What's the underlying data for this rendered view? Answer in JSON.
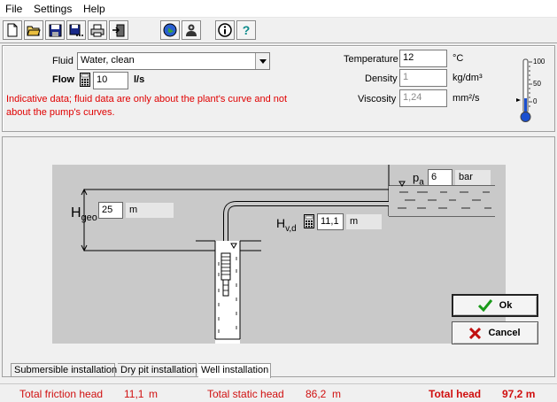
{
  "menu": {
    "file": "File",
    "settings": "Settings",
    "help": "Help"
  },
  "toolbar_icons": [
    "new-document-icon",
    "open-folder-icon",
    "save-icon",
    "save-as-icon",
    "print-icon",
    "exit-icon",
    "globe-icon",
    "user-icon",
    "info-icon",
    "help-icon"
  ],
  "toolbar_labels": {
    "help": "?"
  },
  "fluid": {
    "label": "Fluid",
    "value": "Water, clean",
    "flow_label": "Flow",
    "flow_value": "10",
    "flow_unit": "l/s",
    "note": "Indicative data; fluid data are only about the plant's curve and not about the pump's curves."
  },
  "properties": {
    "temperature_label": "Temperature",
    "temperature_value": "12",
    "temperature_unit": "°C",
    "density_label": "Density",
    "density_value": "1",
    "density_unit": "kg/dm³",
    "viscosity_label": "Viscosity",
    "viscosity_value": "1,24",
    "viscosity_unit": "mm²/s"
  },
  "thermometer": {
    "ticks": [
      "100",
      "50",
      "0"
    ]
  },
  "installation": {
    "pa_label": "p",
    "pa_sub": "a",
    "pa_value": "6",
    "pa_unit": "bar",
    "hgeo_label": "H",
    "hgeo_sub": "geo",
    "hgeo_value": "25",
    "hgeo_unit": "m",
    "hvd_label": "H",
    "hvd_sub": "v,d",
    "hvd_value": "11,1",
    "hvd_unit": "m"
  },
  "buttons": {
    "ok": "Ok",
    "cancel": "Cancel"
  },
  "tabs": [
    "Submersible installation",
    "Dry pit installation",
    "Well installation"
  ],
  "status": {
    "friction_label": "Total friction head",
    "friction_value": "11,1",
    "friction_unit": "m",
    "static_label": "Total static head",
    "static_value": "86,2",
    "static_unit": "m",
    "total_label": "Total head",
    "total_value": "97,2 m"
  },
  "colors": {
    "status_text": "#d01010",
    "note_text": "#e00000",
    "ok_check": "#1a9a1a",
    "cancel_x": "#c01010"
  }
}
